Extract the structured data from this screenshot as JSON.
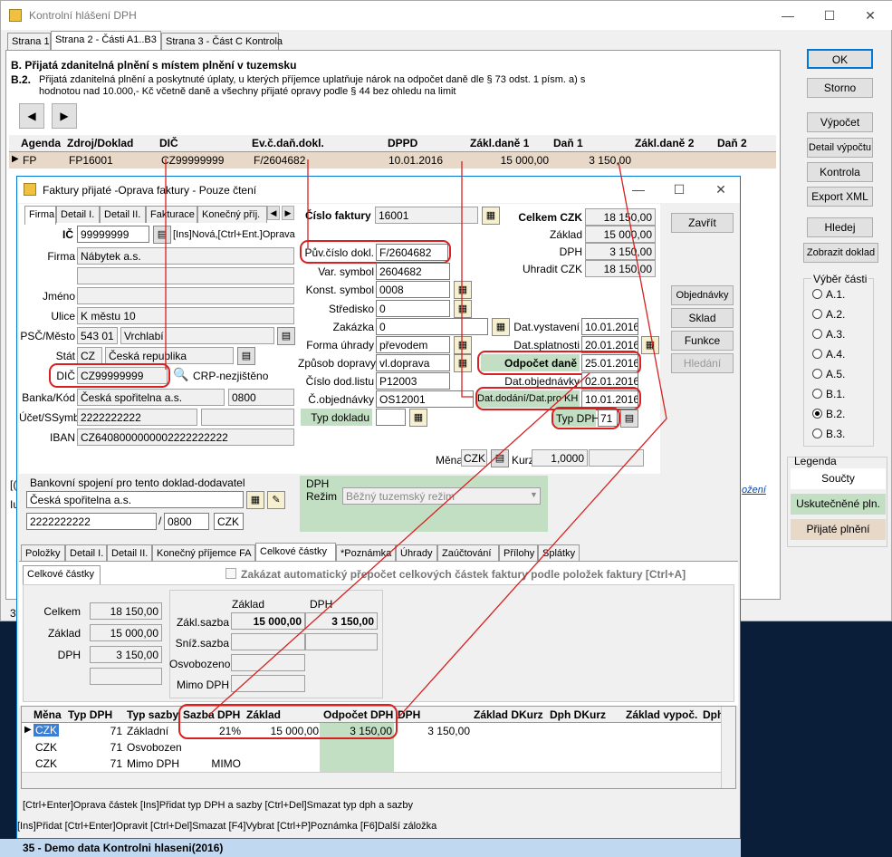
{
  "bg_window": {
    "title": "Kontrolní hlášení DPH",
    "tabs": [
      "Strana 1",
      "Strana 2 - Části A1..B3",
      "Strana 3 - Část C Kontrola"
    ],
    "section_title": "B. Přijatá zdanitelná plnění s místem plnění v tuzemsku",
    "section_sub_code": "B.2.",
    "section_sub_line1": "Přijatá zdanitelná plnění a poskytnuté úplaty, u kterých příjemce uplatňuje nárok na odpočet daně dle § 73 odst. 1 písm. a) s",
    "section_sub_line2": "hodnotou nad 10.000,- Kč včetně daně a všechny přijaté opravy podle § 44 bez ohledu na limit",
    "grid_headers": [
      "Agenda",
      "Zdroj/Doklad",
      "DIČ",
      "Ev.č.daň.dokl.",
      "DPPD",
      "Zákl.daně 1",
      "Daň 1",
      "Zákl.daně 2",
      "Daň 2"
    ],
    "grid_row": [
      "FP",
      "FP16001",
      "CZ99999999",
      "F/2604682",
      "10.01.2016",
      "15 000,00",
      "3 150,00",
      "",
      ""
    ],
    "buttons": [
      "OK",
      "Storno",
      "Výpočet",
      "Detail výpočtu",
      "Kontrola",
      "Export XML",
      "Hledej",
      "Zobrazit doklad"
    ],
    "vyber_title": "Výběr části",
    "radios": [
      "A.1.",
      "A.2.",
      "A.3.",
      "A.4.",
      "A.5.",
      "B.1.",
      "B.2.",
      "B.3."
    ],
    "selected_radio": "B.2.",
    "legenda_title": "Legenda",
    "legend": [
      "Součty",
      "Uskutečněné pln.",
      "Přijaté plnění"
    ],
    "left_edge_1": "[(",
    "left_edge_2": "Iu",
    "left_edge_3": "35",
    "side_link": "ožení"
  },
  "dialog": {
    "title": "Faktury přijaté -Oprava faktury - Pouze čtení",
    "tabs": [
      "Firma",
      "Detail I.",
      "Detail II.",
      "Fakturace",
      "Konečný příj."
    ],
    "ic_label": "IČ",
    "ic": "99999999",
    "ic_hint": "[Ins]Nová,[Ctrl+Ent.]Oprava",
    "firma_label": "Firma",
    "firma": "Nábytek a.s.",
    "jmeno_label": "Jméno",
    "ulice_label": "Ulice",
    "ulice": "K městu 10",
    "psc_label": "PSČ/Město",
    "psc": "543 01",
    "mesto": "Vrchlabí",
    "stat_label": "Stát",
    "stat_code": "CZ",
    "stat": "Česká republika",
    "dic_label": "DIČ",
    "dic": "CZ99999999",
    "crp": "CRP-nezjištěno",
    "banka_label": "Banka/Kód",
    "banka": "Česká spořitelna a.s.",
    "banka_kod": "0800",
    "ucet_label": "Účet/SSymb",
    "ucet": "2222222222",
    "iban_label": "IBAN",
    "iban": "CZ6408000000002222222222",
    "bank_group_title": "Bankovní spojení pro tento doklad-dodavatel",
    "bank_group_name": "Česká spořitelna a.s.",
    "bank_group_ucet": "2222222222",
    "bank_group_kod": "0800",
    "bank_group_mena": "CZK",
    "cislo_label": "Číslo faktury",
    "cislo": "16001",
    "puv_label": "Pův.číslo dokl.",
    "puv": "F/2604682",
    "var_label": "Var. symbol",
    "var": "2604682",
    "konst_label": "Konst. symbol",
    "konst": "0008",
    "stred_label": "Středisko",
    "stred": "0",
    "zakazka_label": "Zakázka",
    "zakazka": "0",
    "forma_label": "Forma úhrady",
    "forma": "převodem",
    "zpusob_label": "Způsob dopravy",
    "zpusob": "vl.doprava",
    "dodlist_label": "Číslo dod.listu",
    "dodlist": "P12003",
    "cobj_label": "Č.objednávky",
    "cobj": "OS12001",
    "typdokl_label": "Typ dokladu",
    "celkem_label": "Celkem CZK",
    "celkem": "18 150,00",
    "zaklad_label": "Základ",
    "zaklad": "15 000,00",
    "dph_label": "DPH",
    "dph": "3 150,00",
    "uhradit_label": "Uhradit CZK",
    "uhradit": "18 150,00",
    "datvyst_label": "Dat.vystavení",
    "datvyst": "10.01.2016",
    "datspl_label": "Dat.splatnosti",
    "datspl": "20.01.2016",
    "odpocet_label": "Odpočet daně",
    "odpocet": "25.01.2016",
    "datobj_label": "Dat.objednávky",
    "datobj": "02.01.2016",
    "datdod_label": "Dat.dodání/Dat.pro KH",
    "datdod": "10.01.2016",
    "typdph_label": "Typ DPH",
    "typdph": "71",
    "mena_label": "Měna",
    "mena": "CZK",
    "kurz_label": "Kurz",
    "kurz": "1,0000",
    "right_buttons": [
      "Zavřít",
      "Objednávky",
      "Sklad",
      "Funkce",
      "Hledání"
    ],
    "dph_rezim_label1": "DPH",
    "dph_rezim_label2": "Režim",
    "dph_rezim": "Běžný tuzemský režim",
    "lower_tabs": [
      "Položky",
      "Detail I.",
      "Detail II.",
      "Konečný příjemce FA",
      "Celkové částky",
      "*Poznámka",
      "Úhrady",
      "Zaúčtování",
      "Přílohy",
      "Splátky"
    ],
    "subtab": "Celkové částky",
    "checkbox_text": "Zakázat automatický přepočet celkových částek faktury podle položek faktury [Ctrl+A]",
    "sum_celkem_label": "Celkem",
    "sum_celkem": "18 150,00",
    "sum_zaklad_label": "Základ",
    "sum_zaklad": "15 000,00",
    "sum_dph_label": "DPH",
    "sum_dph": "3 150,00",
    "col_zaklad": "Základ",
    "col_dph": "DPH",
    "zakl_sazba_label": "Zákl.sazba",
    "zakl_sazba_zaklad": "15 000,00",
    "zakl_sazba_dph": "3 150,00",
    "sniz_label": "Sníž.sazba",
    "osvob_label": "Osvobozeno",
    "mimo_label": "Mimo DPH",
    "vat_headers": [
      "Měna",
      "Typ DPH",
      "Typ sazby",
      "Sazba DPH",
      "Základ",
      "Odpočet DPH",
      "DPH",
      "Základ DKurz",
      "Dph DKurz",
      "Základ vypoč.",
      "Dph"
    ],
    "vat_rows": [
      {
        "mena": "CZK",
        "typ": "71",
        "sazba_typ": "Základní",
        "sazba": "21%",
        "zaklad": "15 000,00",
        "odpocet": "3 150,00",
        "dph": "3 150,00"
      },
      {
        "mena": "CZK",
        "typ": "71",
        "sazba_typ": "Osvobozeno",
        "sazba": "",
        "zaklad": "",
        "odpocet": "",
        "dph": ""
      },
      {
        "mena": "CZK",
        "typ": "71",
        "sazba_typ": "Mimo DPH",
        "sazba": "MIMO",
        "zaklad": "",
        "odpocet": "",
        "dph": ""
      }
    ],
    "hint1": "[Ctrl+Enter]Oprava částek [Ins]Přidat typ DPH a sazby [Ctrl+Del]Smazat typ dph a sazby",
    "hint2": "[Ins]Přidat [Ctrl+Enter]Opravit [Ctrl+Del]Smazat [F4]Vybrat [Ctrl+P]Poznámka [F6]Další záložka"
  },
  "status": "35 - Demo data Kontrolni hlaseni(2016)"
}
